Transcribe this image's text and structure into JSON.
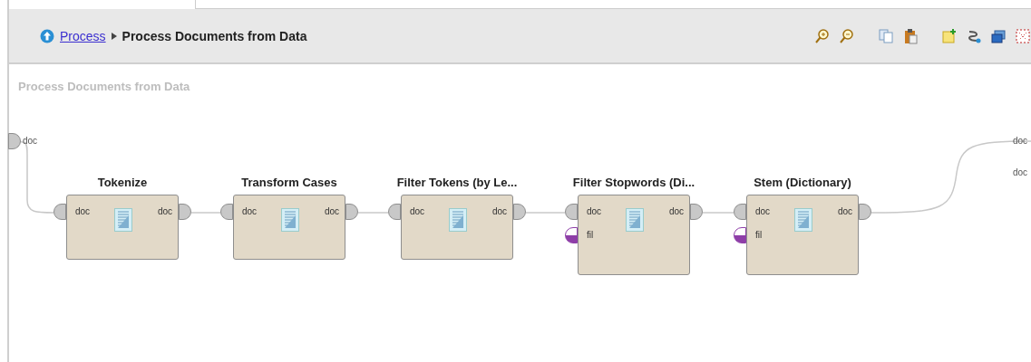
{
  "breadcrumb": {
    "parent": "Process",
    "current": "Process Documents from Data"
  },
  "canvas_title": "Process Documents from Data",
  "input_ports": [
    {
      "label": "doc"
    }
  ],
  "output_ports": [
    {
      "label": "doc"
    },
    {
      "label": "doc"
    }
  ],
  "operators": [
    {
      "title": "Tokenize",
      "ports_in": [
        {
          "label": "doc",
          "kind": "document"
        }
      ],
      "ports_out": [
        {
          "label": "doc"
        }
      ]
    },
    {
      "title": "Transform Cases",
      "ports_in": [
        {
          "label": "doc",
          "kind": "document"
        }
      ],
      "ports_out": [
        {
          "label": "doc"
        }
      ]
    },
    {
      "title": "Filter Tokens (by Le...",
      "ports_in": [
        {
          "label": "doc",
          "kind": "document"
        }
      ],
      "ports_out": [
        {
          "label": "doc"
        }
      ]
    },
    {
      "title": "Filter Stopwords (Di...",
      "ports_in": [
        {
          "label": "doc",
          "kind": "document"
        },
        {
          "label": "fil",
          "kind": "filter"
        }
      ],
      "ports_out": [
        {
          "label": "doc"
        }
      ]
    },
    {
      "title": "Stem (Dictionary)",
      "ports_in": [
        {
          "label": "doc",
          "kind": "document"
        },
        {
          "label": "fil",
          "kind": "filter"
        }
      ],
      "ports_out": [
        {
          "label": "doc"
        }
      ]
    }
  ]
}
